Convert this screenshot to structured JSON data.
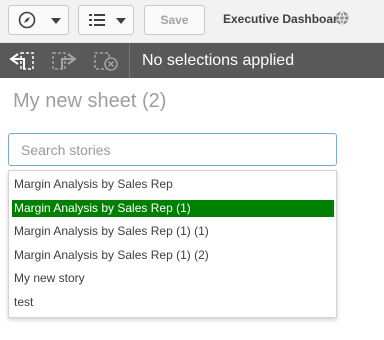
{
  "toolbar": {
    "nav_icon": "compass-icon",
    "sheet_icon": "list-icon",
    "caret_icon": "caret-down-icon",
    "save_label": "Save",
    "app_title": "Executive Dashboard",
    "publish_icon": "globe-icon"
  },
  "selections": {
    "back_icon": "selection-back-icon",
    "forward_icon": "selection-forward-icon",
    "clear_icon": "clear-selections-icon",
    "text": "No selections applied"
  },
  "sheet": {
    "title": "My new sheet (2)"
  },
  "search": {
    "placeholder": "Search stories",
    "value": ""
  },
  "stories": {
    "selected_index": 1,
    "highlight_color": "#008000",
    "items": [
      {
        "label": "Margin Analysis by Sales Rep"
      },
      {
        "label": "Margin Analysis by Sales Rep (1)"
      },
      {
        "label": "Margin Analysis by Sales Rep (1) (1)"
      },
      {
        "label": "Margin Analysis by Sales Rep (1) (2)"
      },
      {
        "label": "My new story"
      },
      {
        "label": "test"
      }
    ]
  }
}
